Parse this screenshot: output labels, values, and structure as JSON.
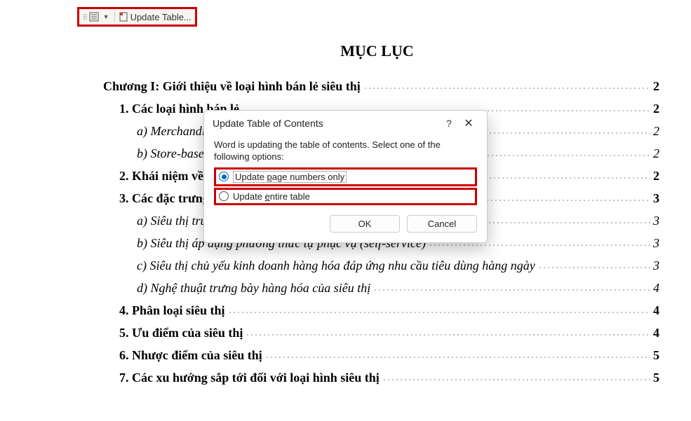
{
  "toolbar": {
    "update_label": "Update Table..."
  },
  "doc": {
    "title": "MỤC LỤC",
    "entries": [
      {
        "text": "Chương I: Giới thiệu về loại hình bán lẻ siêu thị",
        "page": "2",
        "level": 0
      },
      {
        "text": "1. Các loại hình bán lẻ",
        "page": "2",
        "level": 1
      },
      {
        "text": "a) Merchandise",
        "page": "2",
        "level": 2
      },
      {
        "text": "b) Store-based r",
        "page": "2",
        "level": 2
      },
      {
        "text": "2. Khái niệm về s",
        "page": "2",
        "level": 1
      },
      {
        "text": "3. Các đặc trưng",
        "page": "3",
        "level": 1
      },
      {
        "text": "a) Siêu thị trước",
        "page": "3",
        "level": 2
      },
      {
        "text": "b) Siêu thị áp dụng phương thức tự phục vụ (self-service)",
        "page": "3",
        "level": 2
      },
      {
        "text": "c) Siêu thị chủ yếu kinh doanh hàng hóa đáp ứng nhu cầu tiêu dùng hàng ngày",
        "page": "3",
        "level": 2
      },
      {
        "text": "d) Nghệ thuật trưng bày hàng hóa của siêu thị",
        "page": "4",
        "level": 2
      },
      {
        "text": "4. Phân loại siêu thị",
        "page": "4",
        "level": 1
      },
      {
        "text": "5. Ưu điểm của siêu thị",
        "page": "4",
        "level": 1
      },
      {
        "text": "6. Nhược điểm của siêu thị",
        "page": "5",
        "level": 1
      },
      {
        "text": "7. Các xu hướng sắp tới đối với loại hình siêu thị",
        "page": "5",
        "level": 1
      }
    ]
  },
  "dialog": {
    "title": "Update Table of Contents",
    "help": "?",
    "close": "✕",
    "prompt": "Word is updating the table of contents.  Select one of the following options:",
    "option1_pre": "Update ",
    "option1_u": "p",
    "option1_post": "age numbers only",
    "option2_pre": "Update ",
    "option2_u": "e",
    "option2_post": "ntire table",
    "ok": "OK",
    "cancel": "Cancel"
  }
}
